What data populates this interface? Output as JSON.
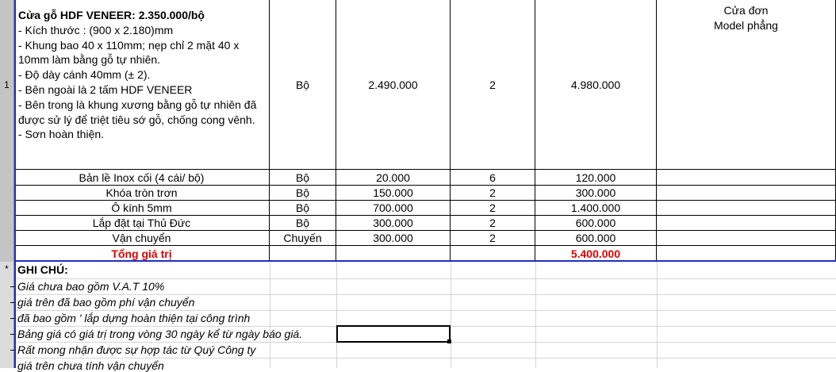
{
  "row_headers": {
    "first": "1",
    "note_marker": "*"
  },
  "product": {
    "title": "Cửa gỗ HDF VENEER: 2.350.000/bộ",
    "description_lines": [
      "- Kích thước : (900 x 2.180)mm",
      "- Khung bao 40 x 110mm; nẹp chỉ 2 mặt 40 x",
      "10mm làm bằng gỗ tự nhiên.",
      "- Độ dày cánh 40mm (± 2).",
      "- Bên ngoài là 2 tấm HDF VENEER",
      "- Bên trong là khung xương bằng gỗ tự nhiên đã",
      "được sử lý để triệt tiêu sớ gỗ, chống cong vênh.",
      "- Sơn hoàn thiện."
    ],
    "unit": "Bộ",
    "price": "2.490.000",
    "qty": "2",
    "total": "4.980.000",
    "note_line1": "Cửa đơn",
    "note_line2": "Model phẳng"
  },
  "items": [
    {
      "name": "Bản lề Inox cối (4 cái/ bộ)",
      "unit": "Bộ",
      "price": "20.000",
      "qty": "6",
      "total": "120.000"
    },
    {
      "name": "Khóa tròn trơn",
      "unit": "Bộ",
      "price": "150.000",
      "qty": "2",
      "total": "300.000"
    },
    {
      "name": "Ô kính 5mm",
      "unit": "Bộ",
      "price": "700.000",
      "qty": "2",
      "total": "1.400.000"
    },
    {
      "name": "Lắp đặt tại Thủ Đức",
      "unit": "Bộ",
      "price": "300.000",
      "qty": "2",
      "total": "600.000"
    },
    {
      "name": "Vận chuyển",
      "unit": "Chuyến",
      "price": "300.000",
      "qty": "2",
      "total": "600.000"
    }
  ],
  "grand_total": {
    "label": "Tổng giá trị",
    "value": "5.400.000"
  },
  "notes": {
    "heading": "GHI CHÚ:",
    "lines": [
      "Giá chưa bao gồm V.A.T 10%",
      "giá trên đã bao gồm phí vận chuyển",
      "đã bao gồm ' lắp dựng hoàn thiện tại công trình",
      "Bảng giá có giá trị trong vòng 30 ngày kể từ ngày báo giá.",
      "Rất mong nhận được sự hợp tác từ Quý Công ty",
      "giá trên chưa tính vận chuyển"
    ]
  },
  "colors": {
    "accent_red": "#e00000",
    "blue_border": "#1f2fbf",
    "row_header_bg": "#c4c4c4"
  }
}
